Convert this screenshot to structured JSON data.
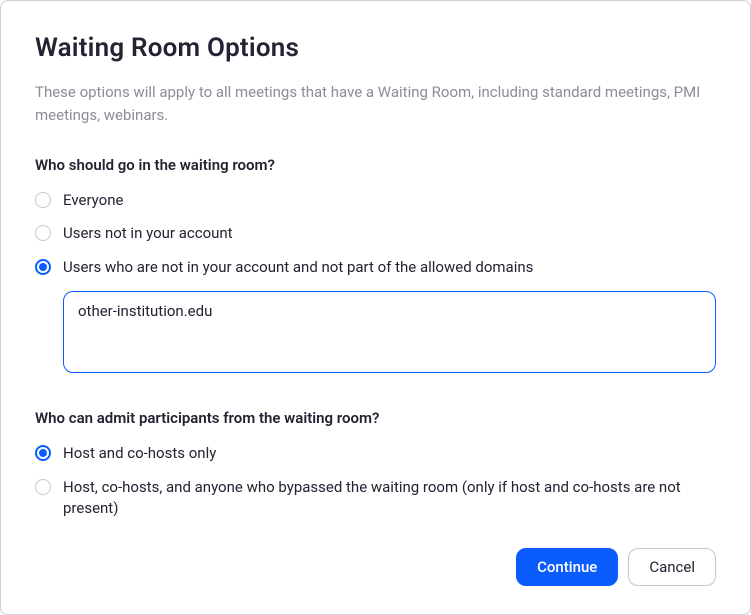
{
  "title": "Waiting Room Options",
  "description": "These options will apply to all meetings that have a Waiting Room, including standard meetings, PMI meetings, webinars.",
  "section1": {
    "heading": "Who should go in the waiting room?",
    "options": [
      {
        "label": "Everyone",
        "selected": false
      },
      {
        "label": "Users not in your account",
        "selected": false
      },
      {
        "label": "Users who are not in your account and not part of the allowed domains",
        "selected": true
      }
    ],
    "domain_value": "other-institution.edu"
  },
  "section2": {
    "heading": "Who can admit participants from the waiting room?",
    "options": [
      {
        "label": "Host and co-hosts only",
        "selected": true
      },
      {
        "label": "Host, co-hosts, and anyone who bypassed the waiting room (only if host and co-hosts are not present)",
        "selected": false
      }
    ]
  },
  "footer": {
    "continue_label": "Continue",
    "cancel_label": "Cancel"
  }
}
